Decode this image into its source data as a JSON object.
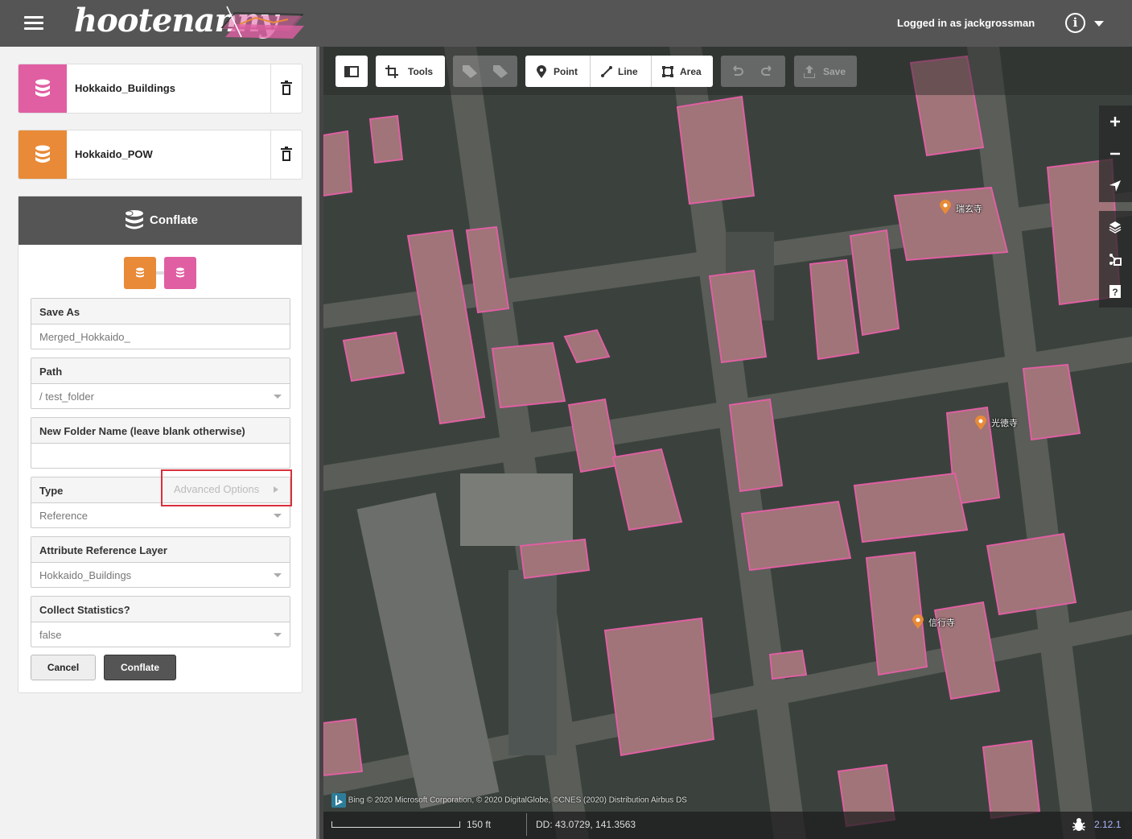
{
  "app": {
    "name": "hootenanny",
    "login_text": "Logged in as jackgrossman"
  },
  "layers": [
    {
      "name": "Hokkaido_Buildings",
      "color": "#e05fa3"
    },
    {
      "name": "Hokkaido_POW",
      "color": "#e88a37"
    }
  ],
  "conflate": {
    "title": "Conflate",
    "fields": [
      {
        "label": "Save As",
        "value": "Merged_Hokkaido_",
        "dropdown": false
      },
      {
        "label": "Path",
        "value": "/ test_folder",
        "dropdown": true
      },
      {
        "label": "New Folder Name (leave blank otherwise)",
        "value": "",
        "dropdown": false
      },
      {
        "label": "Type",
        "value": "Reference",
        "dropdown": true
      },
      {
        "label": "Attribute Reference Layer",
        "value": "Hokkaido_Buildings",
        "dropdown": true
      },
      {
        "label": "Collect Statistics?",
        "value": "false",
        "dropdown": true
      }
    ],
    "advanced_options": "Advanced Options",
    "cancel": "Cancel",
    "submit": "Conflate"
  },
  "toolbar": {
    "tools": "Tools",
    "point": "Point",
    "line": "Line",
    "area": "Area",
    "save": "Save"
  },
  "map": {
    "pois": [
      {
        "label": "瑞玄寺"
      },
      {
        "label": "光徳寺"
      },
      {
        "label": "信行寺"
      }
    ],
    "attribution": "Bing  © 2020 Microsoft Corporation, © 2020 DigitalGlobe, ©CNES (2020) Distribution Airbus DS",
    "scale": "150 ft",
    "coords": "DD: 43.0729, 141.3563",
    "version": "2.12.1"
  },
  "colors": {
    "building_outline": "#e05fa3",
    "poi": "#e88a37",
    "accent_red": "#d9303c"
  }
}
